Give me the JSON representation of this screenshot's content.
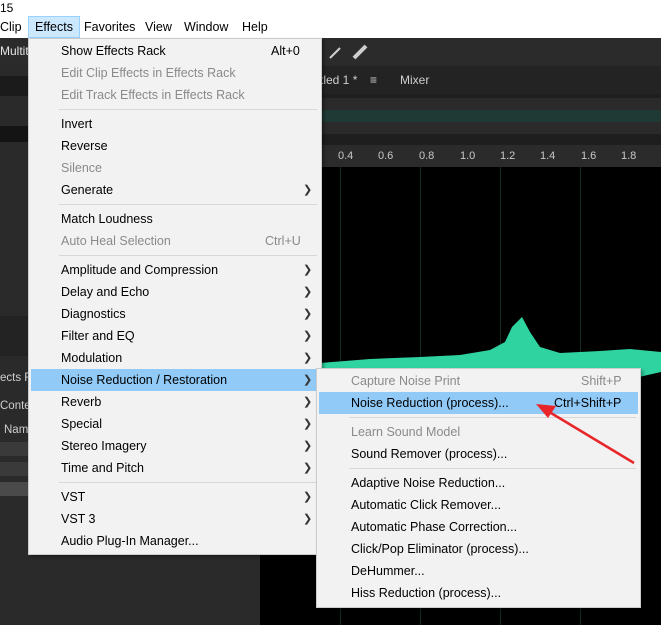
{
  "app": {
    "title_fragment": "15",
    "toolbar_label": "Multitr",
    "left_partial_labels": [
      "ects Ra",
      "Conte",
      "Nam"
    ]
  },
  "menubar": [
    "Clip",
    "Effects",
    "Favorites",
    "View",
    "Window",
    "Help"
  ],
  "tabs": {
    "file_tab": "tled 1 *",
    "tab_menu": "≡",
    "mixer": "Mixer"
  },
  "ruler_ticks": [
    "0.4",
    "0.6",
    "0.8",
    "1.0",
    "1.2",
    "1.4",
    "1.6",
    "1.8"
  ],
  "effects_menu": [
    {
      "label": "Show Effects Rack",
      "shortcut": "Alt+0",
      "enabled": true
    },
    {
      "label": "Edit Clip Effects in Effects Rack",
      "enabled": false
    },
    {
      "label": "Edit Track Effects in Effects Rack",
      "enabled": false
    },
    {
      "label": "Invert",
      "enabled": true
    },
    {
      "label": "Reverse",
      "enabled": true
    },
    {
      "label": "Silence",
      "enabled": false
    },
    {
      "label": "Generate",
      "enabled": true,
      "submenu": true
    },
    {
      "label": "Match Loudness",
      "enabled": true
    },
    {
      "label": "Auto Heal Selection",
      "shortcut": "Ctrl+U",
      "enabled": false
    },
    {
      "label": "Amplitude and Compression",
      "enabled": true,
      "submenu": true
    },
    {
      "label": "Delay and Echo",
      "enabled": true,
      "submenu": true
    },
    {
      "label": "Diagnostics",
      "enabled": true,
      "submenu": true
    },
    {
      "label": "Filter and EQ",
      "enabled": true,
      "submenu": true
    },
    {
      "label": "Modulation",
      "enabled": true,
      "submenu": true
    },
    {
      "label": "Noise Reduction / Restoration",
      "enabled": true,
      "submenu": true,
      "highlighted": true
    },
    {
      "label": "Reverb",
      "enabled": true,
      "submenu": true
    },
    {
      "label": "Special",
      "enabled": true,
      "submenu": true
    },
    {
      "label": "Stereo Imagery",
      "enabled": true,
      "submenu": true
    },
    {
      "label": "Time and Pitch",
      "enabled": true,
      "submenu": true
    },
    {
      "label": "VST",
      "enabled": true,
      "submenu": true
    },
    {
      "label": "VST 3",
      "enabled": true,
      "submenu": true
    },
    {
      "label": "Audio Plug-In Manager...",
      "enabled": true
    }
  ],
  "noise_submenu": [
    {
      "label": "Capture Noise Print",
      "shortcut": "Shift+P",
      "enabled": false
    },
    {
      "label": "Noise Reduction (process)...",
      "shortcut": "Ctrl+Shift+P",
      "enabled": true,
      "highlighted": true
    },
    {
      "label": "Learn Sound Model",
      "enabled": false
    },
    {
      "label": "Sound Remover (process)...",
      "enabled": true
    },
    {
      "label": "Adaptive Noise Reduction...",
      "enabled": true
    },
    {
      "label": "Automatic Click Remover...",
      "enabled": true
    },
    {
      "label": "Automatic Phase Correction...",
      "enabled": true
    },
    {
      "label": "Click/Pop Eliminator (process)...",
      "enabled": true
    },
    {
      "label": "DeHummer...",
      "enabled": true
    },
    {
      "label": "Hiss Reduction (process)...",
      "enabled": true
    }
  ],
  "colors": {
    "highlight": "#91c9f7",
    "waveform": "#2fd3a0",
    "annotation_arrow": "#e8262a"
  }
}
